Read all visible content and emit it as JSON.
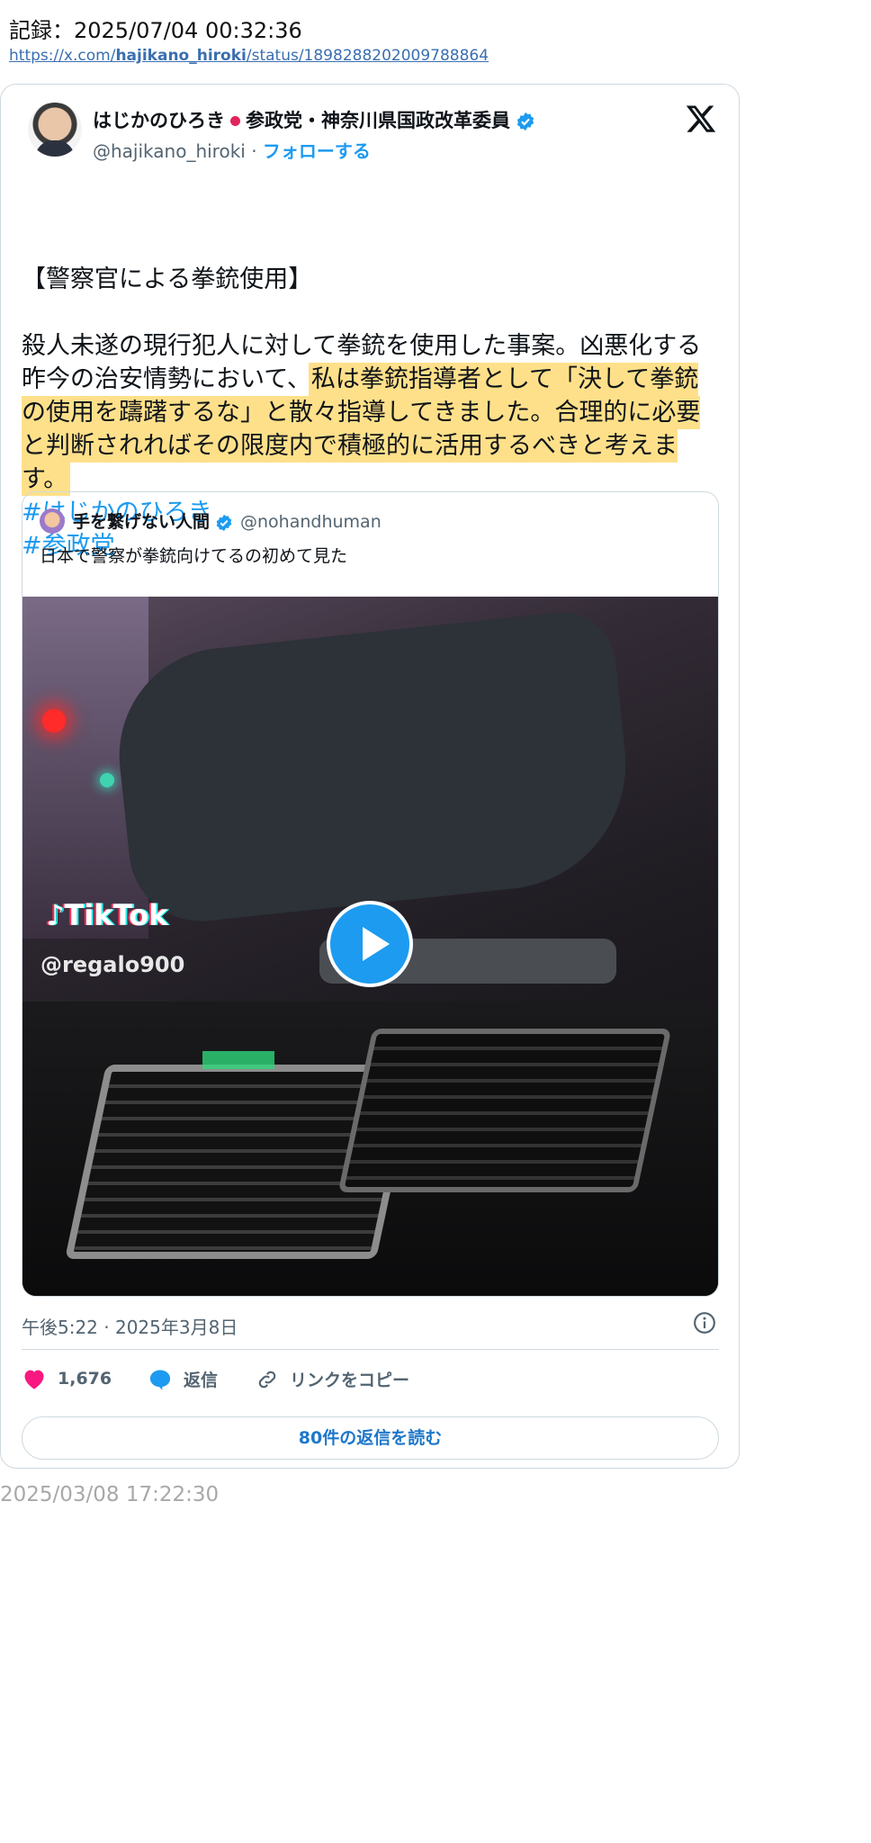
{
  "record": {
    "label": "記録：2025/07/04 00:32:36",
    "url_prefix": "https://x.com/",
    "url_handle": "hajikano_hiroki",
    "url_suffix": "/status/1898288202009788864"
  },
  "tweet": {
    "author_name_1": "はじかのひろき",
    "author_name_2": "参政党・神奈川県国政改革委員",
    "handle": "@hajikano_hiroki",
    "separator": " · ",
    "follow_label": "フォローする",
    "title_line": "【警察官による拳銃使用】",
    "body_plain": "殺人未遂の現行犯人に対して拳銃を使用した事案。凶悪化する昨今の治安情勢において、",
    "body_highlight": "私は拳銃指導者として「決して拳銃の使用を躊躇するな」と散々指導してきました。合理的に必要と判断されればその限度内で積極的に活用するべきと考えます。",
    "hashtags": [
      "#はじかのひろき",
      "#参政党"
    ],
    "timestamp": "午後5:22 · 2025年3月8日",
    "likes": "1,676",
    "reply_label": "返信",
    "copy_link_label": "リンクをコピー",
    "read_replies_label": "80件の返信を読む"
  },
  "quote": {
    "author_name": "手を繋げない人間",
    "handle": "@nohandhuman",
    "text": "日本で警察が拳銃向けてるの初めて見た",
    "video_watermark": "TikTok",
    "video_user": "@regalo900"
  },
  "posted_at": "2025/03/08 17:22:30",
  "colors": {
    "accent": "#1d9bf0",
    "highlight": "#ffe08a",
    "like": "#f91880"
  }
}
